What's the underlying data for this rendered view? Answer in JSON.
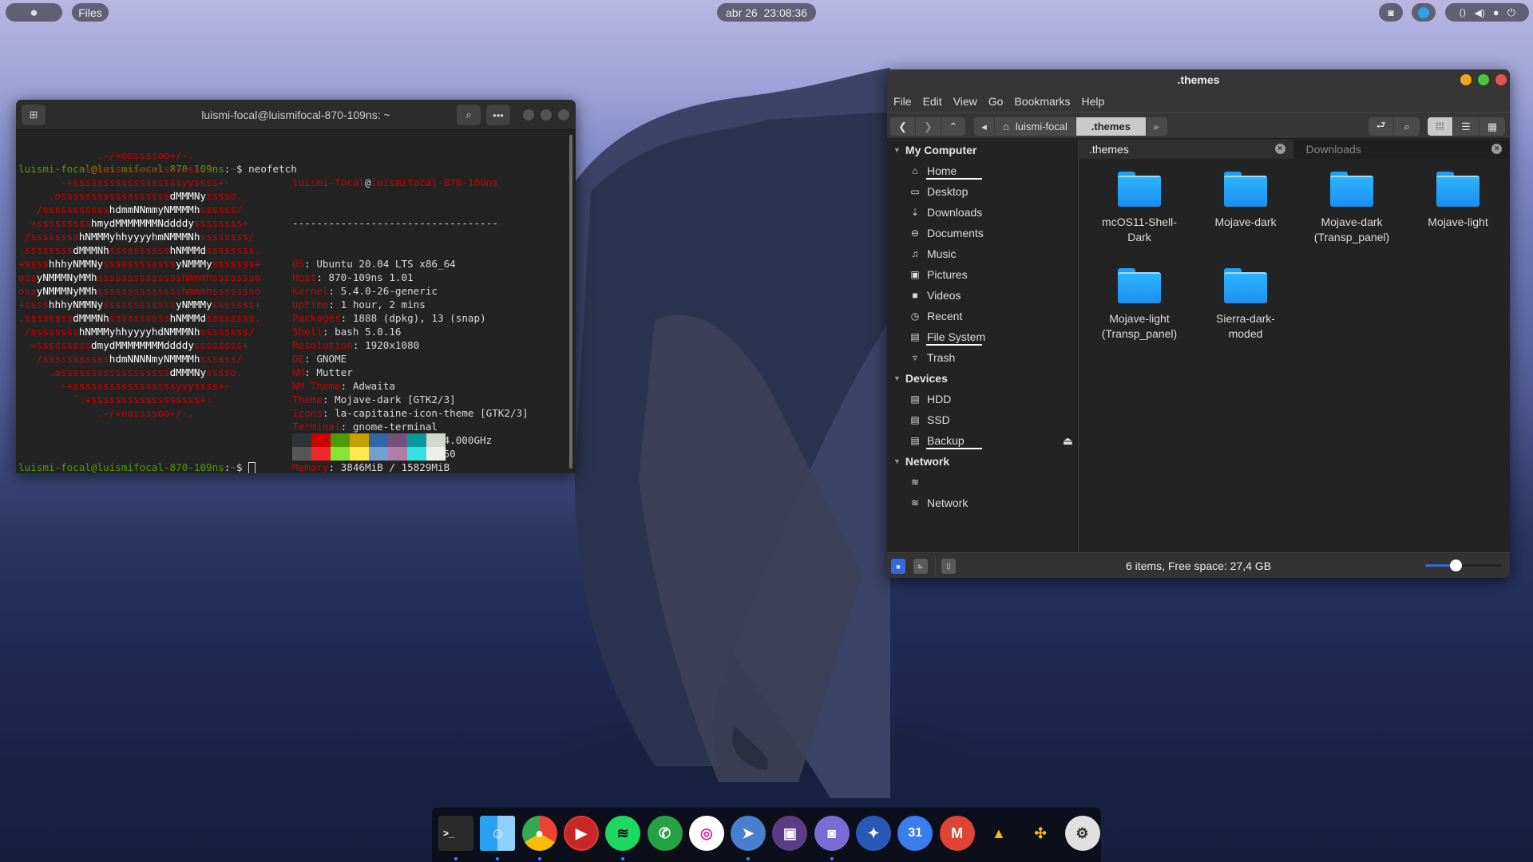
{
  "topbar": {
    "activities_icon": "apple-icon",
    "app_label": "Files",
    "clock": "abr 26  23:08:36",
    "tray": [
      {
        "name": "discord-icon"
      },
      {
        "name": "telegram-icon"
      }
    ],
    "system": [
      "network-icon",
      "volume-icon",
      "microphone-icon",
      "power-icon"
    ]
  },
  "terminal": {
    "title": "luismi-focal@luismifocal-870-109ns: ~",
    "prompt_user": "luismi-focal@luismifocal-870-109ns",
    "prompt_path": "~",
    "prompt_symbol": "$",
    "command": "neofetch",
    "ascii": [
      "             .-/+oossssoo+/-.",
      "         `:+ssssssssssssssssss+:`",
      "       -+ssssssssssssssssssyyssss+-",
      "     .ossssssssssssssssssdMMMNysssso.",
      "   /ssssssssssshdmmNNmmyNMMMMhssssss/",
      "  +ssssssssshmydMMMMMMMNddddyssssssss+",
      " /sssssssshNMMMyhhyyyyhmNMMMNhssssssss/",
      ".ssssssssdMMMNhsssssssssshNMMMdssssssss.",
      "+sssshhhyNMMNyssssssssssssyNMMMysssssss+",
      "ossyNMMMNyMMhsssssssssssssshmmmhssssssso",
      "ossyNMMMNyMMhsssssssssssssshmmmhssssssso",
      "+sssshhhyNMMNyssssssssssssyNMMMysssssss+",
      ".ssssssssdMMMNhsssssssssshNMMMdssssssss.",
      " /sssssssshNMMMyhhyyyyhdNMMMNhssssssss/",
      "  +sssssssssdmydMMMMMMMMddddyssssssss+",
      "   /ssssssssssshdmNNNNmyNMMMMhssssss/",
      "     .ossssssssssssssssssdMMMNysssso.",
      "       -+sssssssssssssssssyyyssss+-",
      "         `:+ssssssssssssssssss+:`",
      "             .-/+oossssoo+/-."
    ],
    "header_user": "luismi-focal",
    "header_host": "luismifocal-870-109ns",
    "separator": "----------------------------------",
    "info": [
      {
        "key": "OS",
        "value": "Ubuntu 20.04 LTS x86_64"
      },
      {
        "key": "Host",
        "value": "870-109ns 1.01"
      },
      {
        "key": "Kernel",
        "value": "5.4.0-26-generic"
      },
      {
        "key": "Uptime",
        "value": "1 hour, 2 mins"
      },
      {
        "key": "Packages",
        "value": "1888 (dpkg), 13 (snap)"
      },
      {
        "key": "Shell",
        "value": "bash 5.0.16"
      },
      {
        "key": "Resolution",
        "value": "1920x1080"
      },
      {
        "key": "DE",
        "value": "GNOME"
      },
      {
        "key": "WM",
        "value": "Mutter"
      },
      {
        "key": "WM Theme",
        "value": "Adwaita"
      },
      {
        "key": "Theme",
        "value": "Mojave-dark [GTK2/3]"
      },
      {
        "key": "Icons",
        "value": "la-capitaine-icon-theme [GTK2/3]"
      },
      {
        "key": "Terminal",
        "value": "gnome-terminal"
      },
      {
        "key": "CPU",
        "value": "Intel i7-6700 (8) @ 4.000GHz"
      },
      {
        "key": "GPU",
        "value": "NVIDIA GeForce GTX 950"
      },
      {
        "key": "Memory",
        "value": "3846MiB / 15829MiB"
      }
    ],
    "palette": [
      "#2e3436",
      "#cc0000",
      "#4e9a06",
      "#c4a000",
      "#3465a4",
      "#75507b",
      "#06989a",
      "#d3d7cf",
      "#555753",
      "#ef2929",
      "#8ae234",
      "#fce94f",
      "#729fcf",
      "#ad7fa8",
      "#34e2e2",
      "#eeeeec"
    ]
  },
  "files": {
    "title": ".themes",
    "menu": [
      "File",
      "Edit",
      "View",
      "Go",
      "Bookmarks",
      "Help"
    ],
    "breadcrumb": [
      "luismi-focal",
      ".themes"
    ],
    "sidebar": [
      {
        "header": "My Computer",
        "items": [
          {
            "label": "Home",
            "icon": "home-icon",
            "glyph": "⌂"
          },
          {
            "label": "Desktop",
            "icon": "desktop-icon",
            "glyph": "▭"
          },
          {
            "label": "Downloads",
            "icon": "download-icon",
            "glyph": "⇣"
          },
          {
            "label": "Documents",
            "icon": "documents-icon",
            "glyph": "⊖"
          },
          {
            "label": "Music",
            "icon": "music-icon",
            "glyph": "♫"
          },
          {
            "label": "Pictures",
            "icon": "pictures-icon",
            "glyph": "▣"
          },
          {
            "label": "Videos",
            "icon": "videos-icon",
            "glyph": "■"
          },
          {
            "label": "Recent",
            "icon": "clock-icon",
            "glyph": "◷"
          },
          {
            "label": "File System",
            "icon": "drive-icon",
            "glyph": "▤"
          },
          {
            "label": "Trash",
            "icon": "trash-icon",
            "glyph": "▿"
          }
        ]
      },
      {
        "header": "Devices",
        "items": [
          {
            "label": "HDD",
            "icon": "drive-icon",
            "glyph": "▤"
          },
          {
            "label": "SSD",
            "icon": "drive-icon",
            "glyph": "▤"
          },
          {
            "label": "Backup",
            "icon": "usb-drive-icon",
            "glyph": "▤"
          }
        ]
      },
      {
        "header": "Network",
        "items": [
          {
            "label": "",
            "icon": "wifi-icon",
            "glyph": "≋"
          },
          {
            "label": "Network",
            "icon": "wifi-icon",
            "glyph": "≋"
          }
        ]
      }
    ],
    "tabs": [
      ".themes",
      "Downloads"
    ],
    "folders": [
      "mcOS11-Shell-Dark",
      "Mojave-dark",
      "Mojave-dark (Transp_panel)",
      "Mojave-light",
      "Mojave-light (Transp_panel)",
      "Sierra-dark-moded"
    ],
    "folder_labels": [
      [
        "mcOS11-Shell-",
        "Dark"
      ],
      [
        "Mojave-dark"
      ],
      [
        "Mojave-dark",
        "(Transp_panel)"
      ],
      [
        "Mojave-light"
      ],
      [
        "Mojave-light",
        "(Transp_panel)"
      ],
      [
        "Sierra-dark-",
        "moded"
      ]
    ],
    "status": "6 items, Free space: 27,4 GB",
    "zoom_level": 0.4
  },
  "dock": [
    {
      "name": "terminal",
      "running": true
    },
    {
      "name": "files",
      "running": true
    },
    {
      "name": "chrome",
      "running": true
    },
    {
      "name": "youtube",
      "running": false
    },
    {
      "name": "spotify",
      "running": true
    },
    {
      "name": "whatsapp",
      "running": false
    },
    {
      "name": "instagram",
      "running": false
    },
    {
      "name": "telegram",
      "running": true
    },
    {
      "name": "twitch",
      "running": false
    },
    {
      "name": "discord",
      "running": true
    },
    {
      "name": "twitter",
      "running": false
    },
    {
      "name": "calendar",
      "running": false
    },
    {
      "name": "gmail",
      "running": false
    },
    {
      "name": "google-drive",
      "running": false
    },
    {
      "name": "pinwheel",
      "running": false
    },
    {
      "name": "steam",
      "running": false
    }
  ],
  "calendar_day": "31",
  "colors": {
    "accent": "#3569dc",
    "folder": "#1ea0f2",
    "close": "#e5534b",
    "min": "#f0a71b",
    "max": "#4cc53b"
  }
}
